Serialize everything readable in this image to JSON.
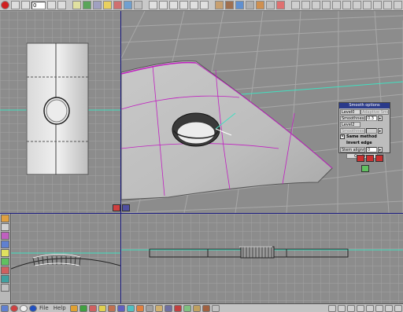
{
  "toolbar": {
    "frame_value": "0"
  },
  "smooth_panel": {
    "title": "Smooth options",
    "level0": "Level0",
    "adapt_smooth": "Adaptive Smooth",
    "smoothness1_label": "Smoothness1",
    "smoothness1_value": "0.3",
    "level2": "Level2",
    "smoothness2_label": "Smoothness2",
    "same_method": "Same method",
    "invert_edge": "Invert edge",
    "stem_alignment_label": "Stem alignment",
    "stem_alignment_value": "0",
    "confirm": "Confirm"
  },
  "bottombar": {
    "file_menu": "File",
    "help_menu": "Help"
  },
  "colors": {
    "viewport_bg": "#8c8c8c",
    "grid": "#a3a3a3",
    "selection": "#c020c0",
    "axis": "#40e0c0"
  }
}
